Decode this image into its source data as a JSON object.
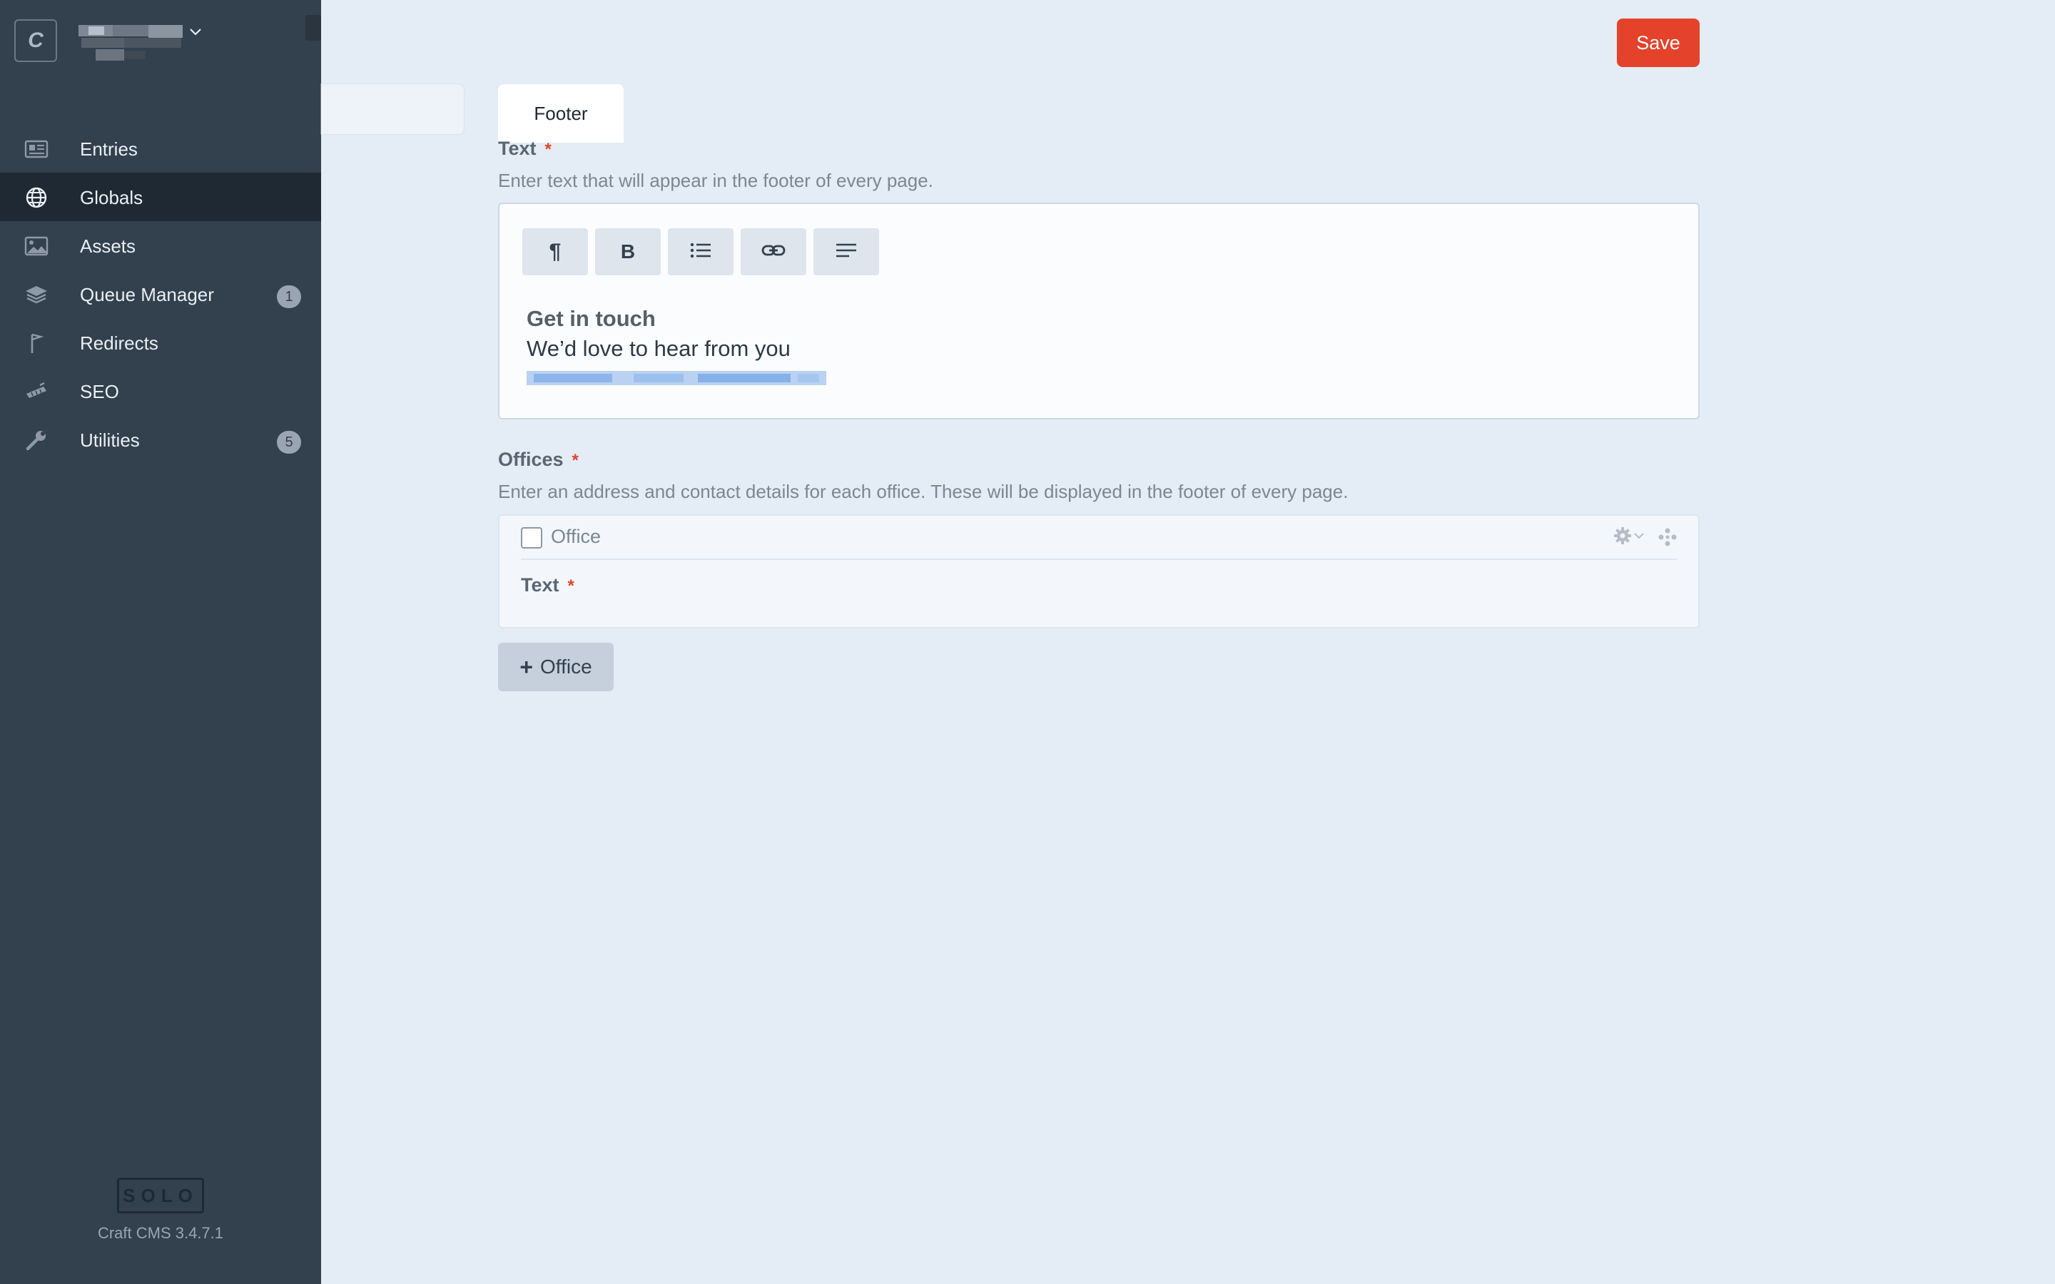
{
  "sidebar": {
    "logo_letter": "C",
    "nav": [
      {
        "label": "Entries",
        "icon": "entries-icon",
        "selected": false,
        "badge": null
      },
      {
        "label": "Globals",
        "icon": "globe-icon",
        "selected": true,
        "badge": null
      },
      {
        "label": "Assets",
        "icon": "image-icon",
        "selected": false,
        "badge": null
      },
      {
        "label": "Queue Manager",
        "icon": "layers-icon",
        "selected": false,
        "badge": "1"
      },
      {
        "label": "Redirects",
        "icon": "flag-icon",
        "selected": false,
        "badge": null
      },
      {
        "label": "SEO",
        "icon": "seo-icon",
        "selected": false,
        "badge": null
      },
      {
        "label": "Utilities",
        "icon": "wrench-icon",
        "selected": false,
        "badge": "5"
      }
    ],
    "edition": "SOLO",
    "version": "Craft CMS 3.4.7.1"
  },
  "header": {
    "save_label": "Save"
  },
  "tabs": [
    {
      "label": "Footer",
      "active": true
    }
  ],
  "fields": {
    "text": {
      "label": "Text",
      "required_mark": "*",
      "instructions": "Enter text that will appear in the footer of every page.",
      "toolbar": [
        {
          "name": "paragraph-format-button",
          "glyph": "¶"
        },
        {
          "name": "bold-button",
          "glyph": "B"
        },
        {
          "name": "list-button",
          "glyph": "list"
        },
        {
          "name": "link-button",
          "glyph": "link"
        },
        {
          "name": "align-button",
          "glyph": "align"
        }
      ],
      "content": {
        "heading": "Get in touch",
        "line": "We’d love to hear from you"
      }
    },
    "offices": {
      "label": "Offices",
      "required_mark": "*",
      "instructions": "Enter an address and contact details for each office. These will be displayed in the footer of every page.",
      "block": {
        "type_label": "Office",
        "field_label": "Text",
        "field_required_mark": "*"
      },
      "add_label": "Office"
    }
  },
  "colors": {
    "sidebar_bg": "#33404d",
    "selected_bg": "#1f2933",
    "page_bg": "#e4ecf5",
    "save_bg": "#e5422b",
    "required": "#e5422b"
  }
}
